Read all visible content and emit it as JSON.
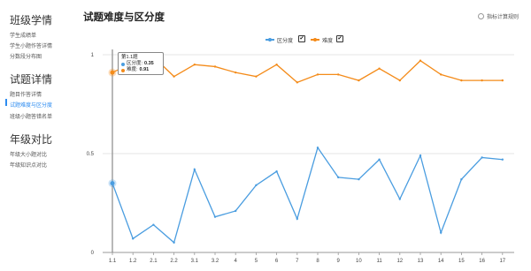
{
  "sidebar": {
    "sections": [
      {
        "title": "班级学情",
        "items": [
          "学生成绩单",
          "学生小题作答详情",
          "分数段分布图"
        ]
      },
      {
        "title": "试题详情",
        "items": [
          "题目作答详情",
          "试题难度与区分度",
          "班级小题答错名单"
        ]
      },
      {
        "title": "年级对比",
        "items": [
          "年级大小题对比",
          "年级知识点对比"
        ]
      }
    ],
    "active_item": "试题难度与区分度"
  },
  "header": {
    "title": "试题难度与区分度",
    "calc_rule_label": "指标计算规则"
  },
  "legend": {
    "items": [
      {
        "label": "区分度",
        "checked": "✔",
        "color": "#4a9de0"
      },
      {
        "label": "难度",
        "checked": "✔",
        "color": "#f48b19"
      }
    ]
  },
  "tooltip": {
    "title": "第1.1题",
    "rows": [
      {
        "label": "区分度:",
        "value": "0.35",
        "color": "#4a9de0"
      },
      {
        "label": "难度:",
        "value": "0.91",
        "color": "#f48b19"
      }
    ]
  },
  "chart_data": {
    "type": "line",
    "categories": [
      "1.1",
      "1.2",
      "2.1",
      "2.2",
      "3.1",
      "3.2",
      "4",
      "5",
      "6",
      "7",
      "8",
      "9",
      "10",
      "11",
      "12",
      "13",
      "14",
      "15",
      "16",
      "17"
    ],
    "series": [
      {
        "name": "区分度",
        "color": "#4a9de0",
        "values": [
          0.35,
          0.07,
          0.14,
          0.05,
          0.42,
          0.18,
          0.21,
          0.34,
          0.41,
          0.17,
          0.53,
          0.38,
          0.37,
          0.47,
          0.27,
          0.49,
          0.1,
          0.37,
          0.48,
          0.47
        ]
      },
      {
        "name": "难度",
        "color": "#f48b19",
        "values": [
          0.91,
          0.96,
          0.99,
          0.89,
          0.95,
          0.94,
          0.91,
          0.89,
          0.95,
          0.86,
          0.9,
          0.9,
          0.87,
          0.93,
          0.87,
          0.97,
          0.9,
          0.87,
          0.87,
          0.87
        ]
      }
    ],
    "y_ticks": [
      "0",
      "0.5",
      "1"
    ],
    "ylim": [
      0,
      1
    ],
    "grid": true,
    "highlight_index": 0
  }
}
